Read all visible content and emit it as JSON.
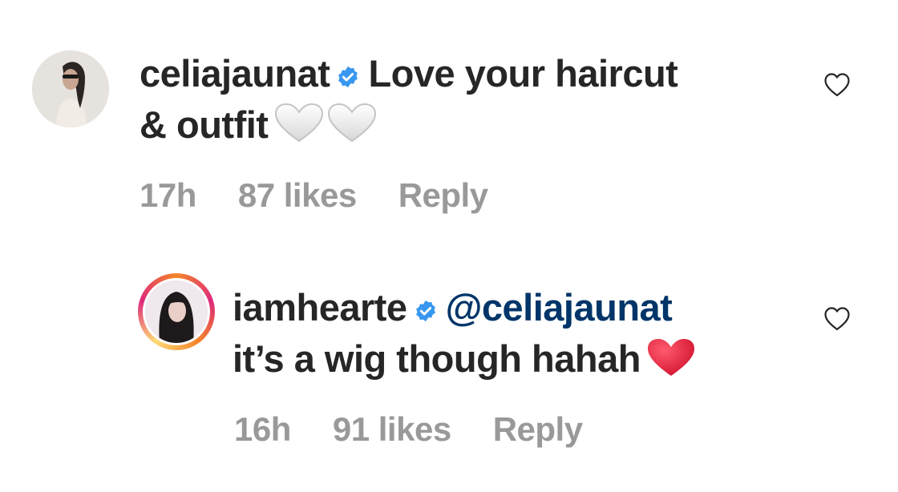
{
  "comments": [
    {
      "username": "celiajaunat",
      "verified": true,
      "text_line1": "Love your haircut",
      "text_line2": "& outfit",
      "emoji": "white-heart-icon",
      "time": "17h",
      "likes": "87 likes",
      "reply_label": "Reply"
    },
    {
      "username": "iamhearte",
      "verified": true,
      "mention": "@celiajaunat",
      "text_line2": "it’s a wig though hahah",
      "emoji": "red-heart-icon",
      "time": "16h",
      "likes": "91 likes",
      "reply_label": "Reply"
    }
  ],
  "colors": {
    "text": "#262626",
    "meta": "#999999",
    "mention": "#003569",
    "verified_badge": "#3897f0",
    "red_heart": "#e0245e"
  }
}
